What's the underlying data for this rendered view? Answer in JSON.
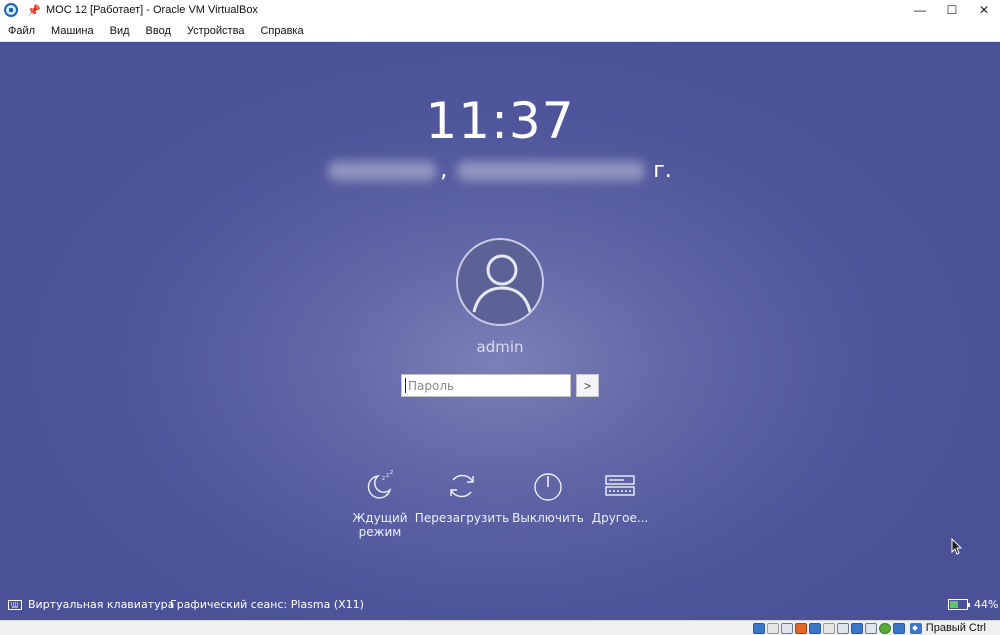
{
  "window": {
    "title": "МОС 12 [Работает] - Oracle VM VirtualBox",
    "minimize_glyph": "—",
    "maximize_glyph": "☐",
    "close_glyph": "✕"
  },
  "menubar": {
    "items": [
      "Файл",
      "Машина",
      "Вид",
      "Ввод",
      "Устройства",
      "Справка"
    ]
  },
  "login": {
    "time": "11:37",
    "date_separator": ",",
    "date_suffix": "г.",
    "user": "admin",
    "password_placeholder": "Пароль",
    "submit_glyph": ">",
    "actions": [
      {
        "label": "Ждущий режим",
        "icon": "sleep-icon"
      },
      {
        "label": "Перезагрузить",
        "icon": "restart-icon"
      },
      {
        "label": "Выключить",
        "icon": "power-icon"
      },
      {
        "label": "Другое...",
        "icon": "other-sessions-icon"
      }
    ]
  },
  "bottom": {
    "virtual_keyboard": "Виртуальная клавиатура",
    "session": "Графический сеанс: Plasma (X11)",
    "battery_percent": "44%",
    "battery_level": 0.44
  },
  "statusbar": {
    "host_key": "Правый Ctrl"
  },
  "colors": {
    "desktop_bg": "#4f569b",
    "accent": "#1c62b5"
  }
}
